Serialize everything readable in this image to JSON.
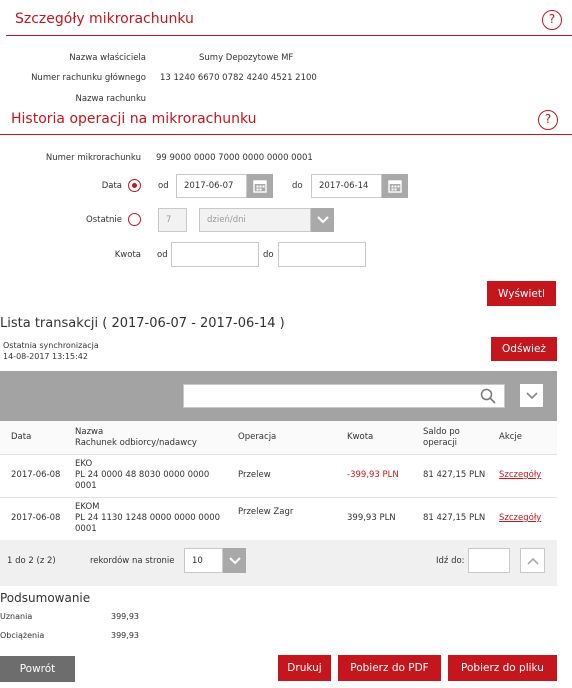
{
  "details": {
    "title": "Szczegóły mikrorachunku",
    "help": "?",
    "fields": [
      {
        "label": "Nazwa właściciela",
        "value": "Sumy Depozytowe MF"
      },
      {
        "label": "Numer rachunku głównego",
        "value": "13 1240 6670 0782 4240 4521 2100"
      },
      {
        "label": "Nazwa rachunku",
        "value": ""
      }
    ]
  },
  "history": {
    "title": "Historia operacji na mikrorachunku",
    "help": "?",
    "micro_account_label": "Numer mikrorachunku",
    "micro_account_value": "99 9000 0000 7000 0000 0000 0001",
    "date_label": "Data",
    "from_label": "od",
    "to_label": "do",
    "date_from": "2017-06-07",
    "date_to": "2017-06-14",
    "last_label": "Ostatnie",
    "last_value": "7",
    "last_unit": "dzień/dni",
    "amount_label": "Kwota",
    "amount_from_label": "od",
    "amount_to_label": "do",
    "show_button": "Wyświetl"
  },
  "transactions": {
    "heading": "Lista transakcji  ( 2017-06-07  -  2017-06-14 )",
    "sync_label": "Ostatnia synchronizacja",
    "sync_time": "14-08-2017 13:15:42",
    "refresh_button": "Odśwież",
    "columns": {
      "date": "Data",
      "name": "Nazwa",
      "account": "Rachunek odbiorcy/nadawcy",
      "operation": "Operacja",
      "amount": "Kwota",
      "balance_1": "Saldo po",
      "balance_2": "operacji",
      "actions": "Akcje"
    },
    "rows": [
      {
        "date": "2017-06-08",
        "name": "EKO",
        "acc1": "PL 24 0000 48 8030 0000 0000",
        "acc2": "0001",
        "operation": "Przelew",
        "amount": "-399,93 PLN",
        "balance": "81 427,15 PLN",
        "action": "Szczegóły"
      },
      {
        "date": "2017-06-08",
        "name": "EKOM",
        "acc1": "PL 24 1130 1248 0000 0000 0000",
        "acc2": "0001",
        "operation": "Przelew Zagr",
        "amount": "399,93 PLN",
        "balance": "81 427,15 PLN",
        "action": "Szczegóły"
      }
    ],
    "pager": {
      "range": "1 do 2 (z 2)",
      "per_page_label": "rekordów na stronie",
      "per_page": "10",
      "goto_label": "Idź do:"
    }
  },
  "summary": {
    "title": "Podsumowanie",
    "credits_label": "Uznania",
    "credits_value": "399,93",
    "debits_label": "Obciążenia",
    "debits_value": "399,93"
  },
  "footer": {
    "back": "Powrót",
    "print": "Drukuj",
    "pdf": "Pobierz do PDF",
    "file": "Pobierz do pliku"
  },
  "colors": {
    "accent": "#c4161c",
    "toolbar": "#a3a3a3",
    "back": "#6d6d6d"
  }
}
